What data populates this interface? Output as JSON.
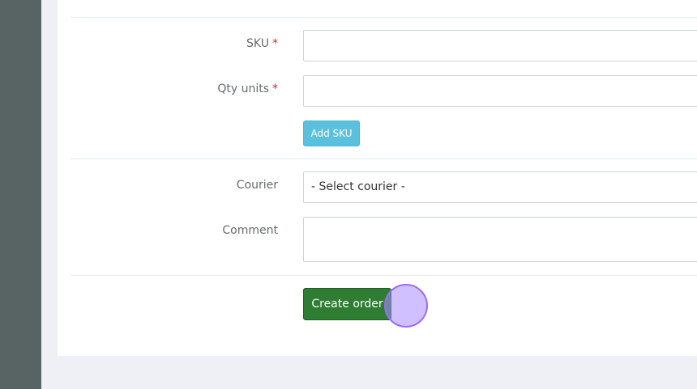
{
  "form": {
    "sku_label": "SKU",
    "qty_label": "Qty units",
    "required_marker": "*",
    "sku_value": "",
    "qty_value": "",
    "add_sku_label": "Add SKU",
    "courier_label": "Courier",
    "courier_selected": "- Select courier -",
    "comment_label": "Comment",
    "comment_value": "",
    "create_order_label": "Create order"
  },
  "colors": {
    "sidebar": "#576463",
    "add_button": "#5bc0de",
    "create_button": "#2e7d32",
    "required": "#cc2a2a"
  }
}
